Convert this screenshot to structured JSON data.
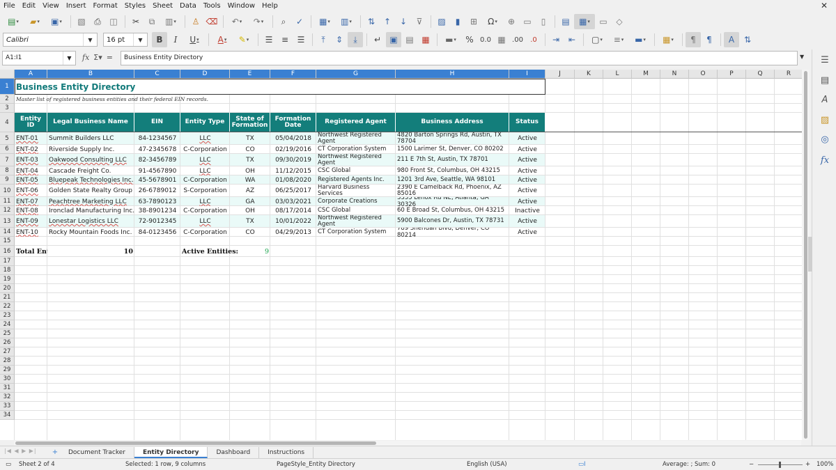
{
  "menu": [
    "File",
    "Edit",
    "View",
    "Insert",
    "Format",
    "Styles",
    "Sheet",
    "Data",
    "Tools",
    "Window",
    "Help"
  ],
  "font": {
    "name": "Calibri",
    "size": "16 pt"
  },
  "formula_bar": {
    "cell_ref": "A1:I1",
    "content": "Business Entity Directory"
  },
  "columns": [
    "A",
    "B",
    "C",
    "D",
    "E",
    "F",
    "G",
    "H",
    "I",
    "J",
    "K",
    "L",
    "M",
    "N",
    "O",
    "P",
    "Q",
    "R"
  ],
  "rows": [
    "1",
    "2",
    "3",
    "4",
    "5",
    "6",
    "7",
    "8",
    "9",
    "10",
    "11",
    "12",
    "13",
    "14",
    "15",
    "16",
    "17",
    "18",
    "19",
    "20",
    "21",
    "22",
    "23",
    "24",
    "25",
    "26",
    "27",
    "28",
    "29",
    "30",
    "31",
    "32",
    "33",
    "34"
  ],
  "sheet": {
    "title": "Business Entity Directory",
    "subtitle": "Master list of registered business entities and their federal EIN records.",
    "headers": [
      "Entity ID",
      "Legal Business Name",
      "EIN",
      "Entity Type",
      "State of Formation",
      "Formation Date",
      "Registered Agent",
      "Business Address",
      "Status"
    ],
    "records": [
      [
        "ENT-01",
        "Summit Builders LLC",
        "84-1234567",
        "LLC",
        "TX",
        "05/04/2018",
        "Northwest Registered Agent",
        "4820 Barton Springs Rd, Austin, TX 78704",
        "Active"
      ],
      [
        "ENT-02",
        "Riverside Supply Inc.",
        "47-2345678",
        "C-Corporation",
        "CO",
        "02/19/2016",
        "CT Corporation System",
        "1500 Larimer St, Denver, CO 80202",
        "Active"
      ],
      [
        "ENT-03",
        "Oakwood Consulting LLC",
        "82-3456789",
        "LLC",
        "TX",
        "09/30/2019",
        "Northwest Registered Agent",
        "211 E 7th St, Austin, TX 78701",
        "Active"
      ],
      [
        "ENT-04",
        "Cascade Freight Co.",
        "91-4567890",
        "LLC",
        "OH",
        "11/12/2015",
        "CSC Global",
        "980 Front St, Columbus, OH 43215",
        "Active"
      ],
      [
        "ENT-05",
        "Bluepeak Technologies Inc.",
        "45-5678901",
        "C-Corporation",
        "WA",
        "01/08/2020",
        "Registered Agents Inc.",
        "1201 3rd Ave, Seattle, WA 98101",
        "Active"
      ],
      [
        "ENT-06",
        "Golden State Realty Group",
        "26-6789012",
        "S-Corporation",
        "AZ",
        "06/25/2017",
        "Harvard Business Services",
        "2390 E Camelback Rd, Phoenix, AZ 85016",
        "Active"
      ],
      [
        "ENT-07",
        "Peachtree Marketing LLC",
        "63-7890123",
        "LLC",
        "GA",
        "03/03/2021",
        "Corporate Creations",
        "3355 Lenox Rd NE, Atlanta, GA 30326",
        "Active"
      ],
      [
        "ENT-08",
        "Ironclad Manufacturing Inc.",
        "38-8901234",
        "C-Corporation",
        "OH",
        "08/17/2014",
        "CSC Global",
        "60 E Broad St, Columbus, OH 43215",
        "Inactive"
      ],
      [
        "ENT-09",
        "Lonestar Logistics LLC",
        "72-9012345",
        "LLC",
        "TX",
        "10/01/2022",
        "Northwest Registered Agent",
        "5900 Balcones Dr, Austin, TX 78731",
        "Active"
      ],
      [
        "ENT-10",
        "Rocky Mountain Foods Inc.",
        "84-0123456",
        "C-Corporation",
        "CO",
        "04/29/2013",
        "CT Corporation System",
        "789 Sheridan Blvd, Denver, CO 80214",
        "Active"
      ]
    ],
    "totals": {
      "label": "Total Enti",
      "count": "10",
      "active_label": "Active Entities:",
      "active_count": "9"
    }
  },
  "tabs": [
    "Document Tracker",
    "Entity Directory",
    "Dashboard",
    "Instructions"
  ],
  "active_tab": "Entity Directory",
  "status": {
    "sheet": "Sheet 2 of 4",
    "selection": "Selected: 1 row, 9 columns",
    "page_style": "PageStyle_Entity Directory",
    "language": "English (USA)",
    "summary": "Average: ; Sum: 0",
    "zoom": "100%"
  },
  "colors": {
    "accent": "#137e7b",
    "title": "#127a7a",
    "row_alt": "#eafaf8",
    "selection": "#3a80d2",
    "active_count": "#17a34a"
  }
}
